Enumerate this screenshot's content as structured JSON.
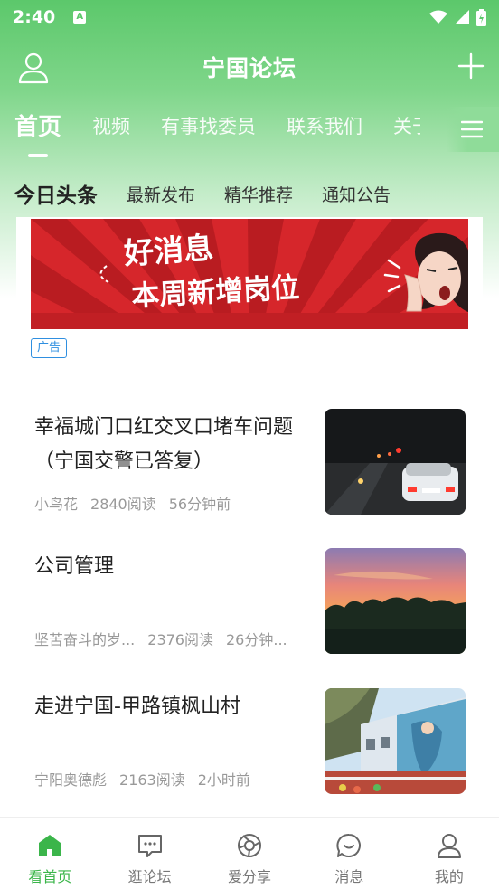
{
  "status_bar": {
    "time": "2:40",
    "notif": "A"
  },
  "header": {
    "title": "宁国论坛"
  },
  "primary_tabs": [
    "首页",
    "视频",
    "有事找委员",
    "联系我们",
    "关于"
  ],
  "secondary_tabs": [
    "今日头条",
    "最新发布",
    "精华推荐",
    "通知公告"
  ],
  "banner": {
    "line1": "好消息",
    "line2": "本周新增岗位",
    "ad_label": "广告"
  },
  "news": [
    {
      "title": "幸福城门口红交叉口堵车问题（宁国交警已答复）",
      "author": "小鸟花",
      "reads": "2840阅读",
      "time": "56分钟前"
    },
    {
      "title": "公司管理",
      "author": "坚苦奋斗的岁...",
      "reads": "2376阅读",
      "time": "26分钟..."
    },
    {
      "title": "走进宁国-甲路镇枫山村",
      "author": "宁阳奥德彪",
      "reads": "2163阅读",
      "time": "2小时前"
    }
  ],
  "bottom_nav": [
    "看首页",
    "逛论坛",
    "爱分享",
    "消息",
    "我的"
  ],
  "colors": {
    "accent": "#3bb54a",
    "header_green": "#5cc86b",
    "ad_blue": "#2f8fe0"
  }
}
